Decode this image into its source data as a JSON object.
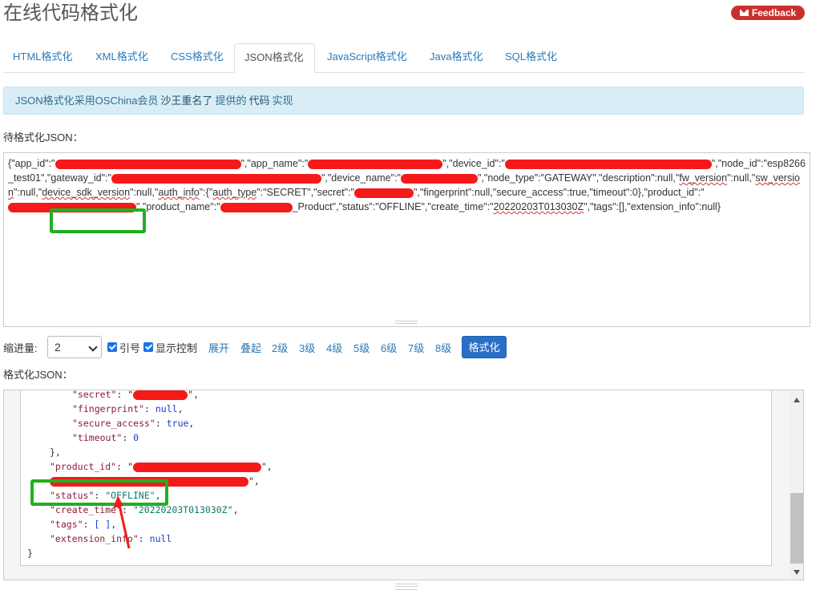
{
  "page": {
    "title": "在线代码格式化",
    "feedback": "Feedback"
  },
  "tabs": [
    "HTML格式化",
    "XML格式化",
    "CSS格式化",
    "JSON格式化",
    "JavaScript格式化",
    "Java格式化",
    "SQL格式化"
  ],
  "info": {
    "prefix": "JSON格式化采用OSChina会员",
    "member": "沙王重名了",
    "mid": "提供的",
    "code": "代码",
    "suffix": "实现"
  },
  "input": {
    "label": "待格式化JSON：",
    "t1": "{\"app_id\":\"",
    "t2": "\",\"app_name\":\"",
    "t3": "\",\"device_id\":\"",
    "t4": "\",\"node_id\":\"esp8266_test01\",\"gateway_id\":\"",
    "t5": "\",\"device_name\":\"",
    "t6": "\",\"node_type\":\"GATEWAY\",\"description\":null,\"",
    "t7": "fw_version",
    "t8": "\":null,\"",
    "t9": "sw_version",
    "t10": "\":null,\"",
    "t11": "device_sdk_version",
    "t12": "\":null,\"",
    "t13": "auth_info",
    "t14": "\":{\"",
    "t15": "auth_type",
    "t16": "\":\"SECRET\",\"secret\":\"",
    "t17": "\",\"fingerprint\":null,\"secure_access\":true,\"timeout\":0},\"product_id\":\"",
    "t18": "\",\"product_name\":\"",
    "t19": "_Product\",",
    "t20": "\"status\":\"OFFLINE\"",
    "t21": ",\"create_time\":\"",
    "t22": "20220203T013030Z",
    "t23": "\",\"tags\":[],\"extension_info\":null}"
  },
  "toolbar": {
    "indent_label": "缩进量:",
    "indent_value": "2",
    "quote_label": "引号",
    "control_label": "显示控制",
    "expand": "展开",
    "collapse": "叠起",
    "levels": [
      "2级",
      "3级",
      "4级",
      "5级",
      "6级",
      "7级",
      "8级"
    ],
    "format_button": "格式化"
  },
  "output": {
    "label": "格式化JSON：",
    "l1": {
      "key": "\"secret\"",
      "colon": ": \"",
      "tail": "\","
    },
    "l2": {
      "key": "\"fingerprint\"",
      "colon": ": ",
      "val": "null",
      "tail": ","
    },
    "l3": {
      "key": "\"secure_access\"",
      "colon": ": ",
      "val": "true",
      "tail": ","
    },
    "l4": {
      "key": "\"timeout\"",
      "colon": ": ",
      "val": "0"
    },
    "l5": "},",
    "l6": {
      "key": "\"product_id\"",
      "colon": ": \"",
      "tail": "\","
    },
    "l7": {
      "tail": "\","
    },
    "l8": {
      "key": "\"status\"",
      "colon": ": ",
      "val": "\"OFFLINE\"",
      "tail": ","
    },
    "l9": {
      "key": "\"create_time\"",
      "colon": ": ",
      "val": "\"20220203T013030Z\"",
      "tail": ","
    },
    "l10": {
      "key": "\"tags\"",
      "colon": ": ",
      "val": "[ ]",
      "tail": ","
    },
    "l11": {
      "key": "\"extension_info\"",
      "colon": ": ",
      "val": "null"
    },
    "l12": "}"
  },
  "colors": {
    "highlight": "#20b020",
    "redaction": "#f41a1a",
    "arrow": "#f41a1a",
    "link": "#2a7ab8"
  }
}
